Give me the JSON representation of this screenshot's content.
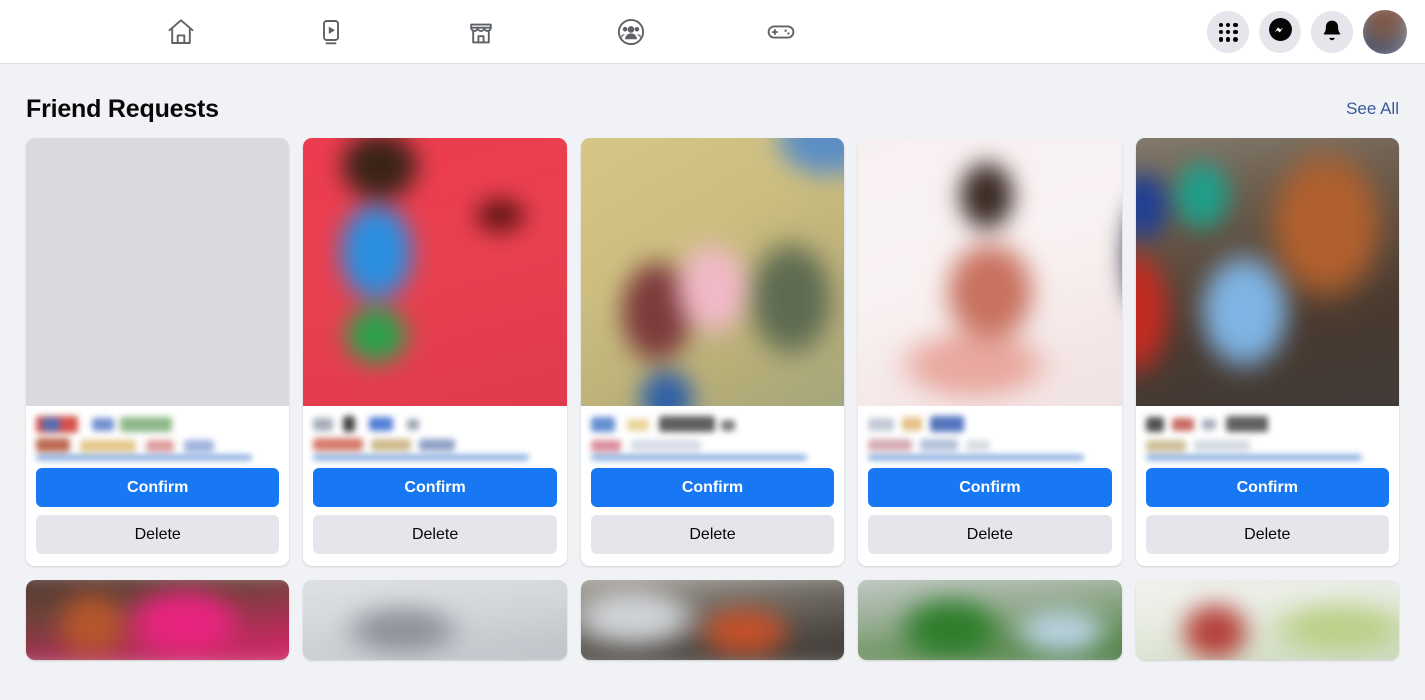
{
  "header": {
    "nav_tabs": [
      {
        "name": "home",
        "icon": "home-icon"
      },
      {
        "name": "watch",
        "icon": "video-icon"
      },
      {
        "name": "marketplace",
        "icon": "marketplace-icon"
      },
      {
        "name": "groups",
        "icon": "groups-icon"
      },
      {
        "name": "gaming",
        "icon": "gaming-controller-icon"
      }
    ],
    "actions": [
      {
        "name": "menu",
        "icon": "grid-menu-icon"
      },
      {
        "name": "messenger",
        "icon": "messenger-icon"
      },
      {
        "name": "notifications",
        "icon": "bell-icon"
      },
      {
        "name": "profile",
        "icon": "avatar"
      }
    ]
  },
  "section": {
    "title": "Friend Requests",
    "see_all_label": "See All"
  },
  "buttons": {
    "confirm_label": "Confirm",
    "delete_label": "Delete"
  },
  "colors": {
    "accent_blue": "#1877f2",
    "link_blue": "#3b5998",
    "page_background": "#f0f2f5",
    "card_background": "#ffffff",
    "secondary_button": "#e4e6eb",
    "text_primary": "#050505"
  },
  "requests": [
    {
      "photo": "ph1",
      "name_redacted": true
    },
    {
      "photo": "ph2",
      "name_redacted": true
    },
    {
      "photo": "ph3",
      "name_redacted": true
    },
    {
      "photo": "ph4",
      "name_redacted": true
    },
    {
      "photo": "ph5",
      "name_redacted": true
    }
  ],
  "requests_row2": [
    {
      "photo": "ph6",
      "name_redacted": true
    },
    {
      "photo": "ph7",
      "name_redacted": true
    },
    {
      "photo": "ph8",
      "name_redacted": true
    },
    {
      "photo": "ph9",
      "name_redacted": true
    },
    {
      "photo": "ph10",
      "name_redacted": true
    }
  ]
}
